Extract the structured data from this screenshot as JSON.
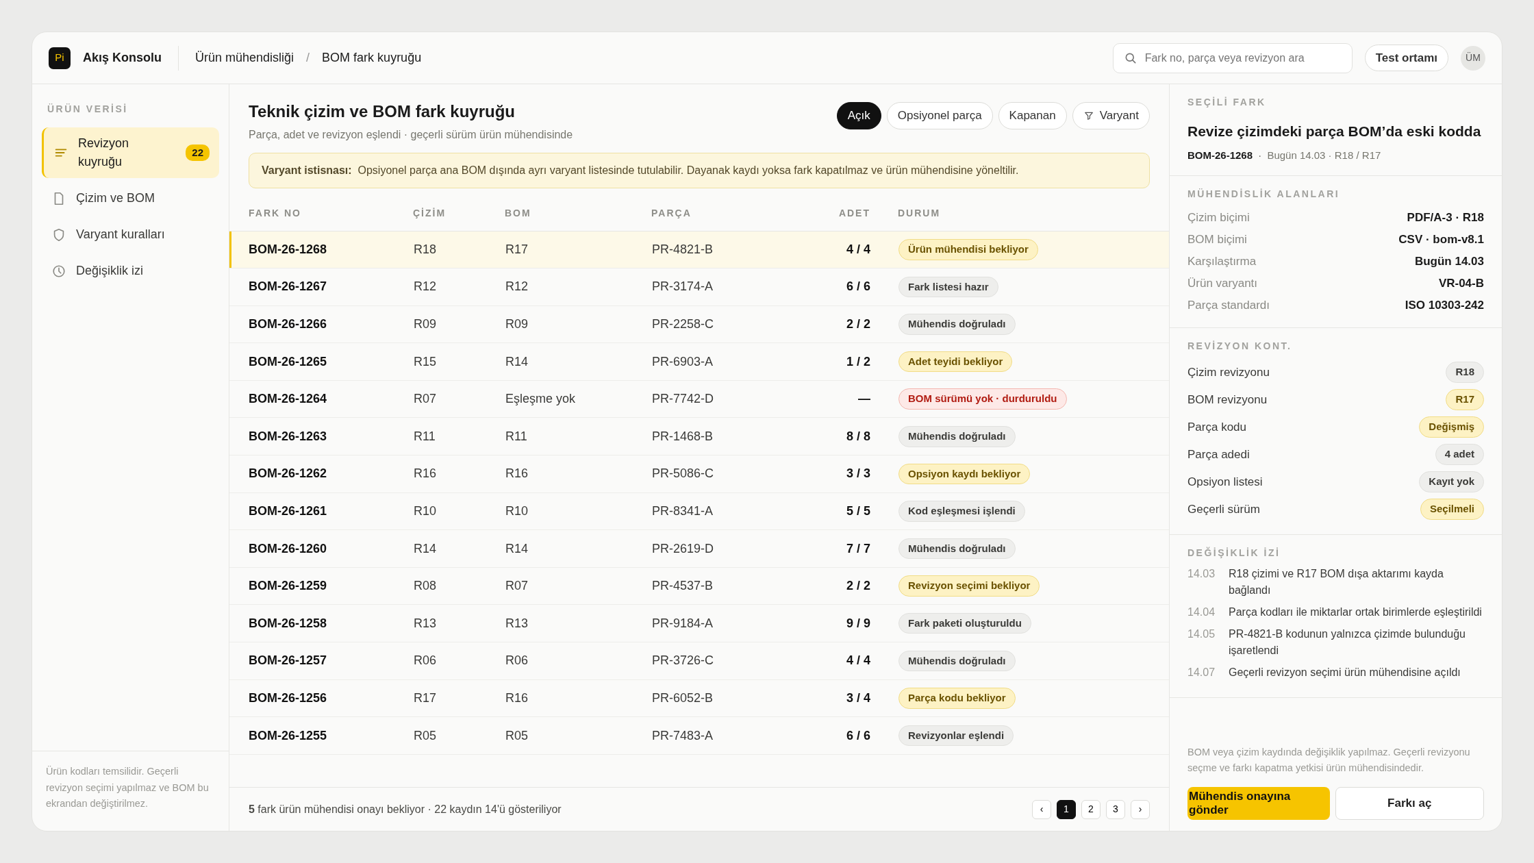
{
  "app": {
    "logo": "Pi",
    "name": "Akış Konsolu"
  },
  "breadcrumb": [
    "Ürün mühendisliği",
    "BOM fark kuyruğu"
  ],
  "breadcrumb_separator": "/",
  "search": {
    "placeholder": "Fark no, parça veya revizyon ara"
  },
  "environment": "Test ortamı",
  "avatar": "ÜM",
  "sidebar": {
    "heading": "ÜRÜN VERİSİ",
    "items": [
      {
        "label": "Revizyon kuyruğu",
        "badge": "22",
        "selected": true
      },
      {
        "label": "Çizim ve BOM",
        "selected": false
      },
      {
        "label": "Varyant kuralları",
        "selected": false
      },
      {
        "label": "Değişiklik izi",
        "selected": false
      }
    ],
    "note": "Ürün kodları temsilidir. Geçerli revizyon seçimi yapılmaz ve BOM bu ekrandan değiştirilmez."
  },
  "main": {
    "title": "Teknik çizim ve BOM fark kuyruğu",
    "subtitle": "Parça, adet ve revizyon eşlendi · geçerli sürüm ürün mühendisinde",
    "filters": [
      {
        "label": "Açık",
        "selected": true
      },
      {
        "label": "Opsiyonel parça",
        "selected": false
      },
      {
        "label": "Kapanan",
        "selected": false
      },
      {
        "label": "Varyant",
        "selected": false,
        "kind": "filter"
      }
    ],
    "alert": {
      "label": "Varyant istisnası:",
      "text": "Opsiyonel parça ana BOM dışında ayrı varyant listesinde tutulabilir. Dayanak kaydı yoksa fark kapatılmaz ve ürün mühendisine yöneltilir."
    }
  },
  "table": {
    "columns": [
      "FARK NO",
      "ÇİZİM",
      "BOM",
      "PARÇA",
      "ADET",
      "DURUM"
    ],
    "rows": [
      {
        "id": "BOM-26-1268",
        "drawing": "R18",
        "bom": "R17",
        "part": "PR-4821-B",
        "qty": "4 / 4",
        "status": "Ürün mühendisi bekliyor",
        "kind": "warning",
        "selected": true
      },
      {
        "id": "BOM-26-1267",
        "drawing": "R12",
        "bom": "R12",
        "part": "PR-3174-A",
        "qty": "6 / 6",
        "status": "Fark listesi hazır",
        "kind": "neutral",
        "selected": false
      },
      {
        "id": "BOM-26-1266",
        "drawing": "R09",
        "bom": "R09",
        "part": "PR-2258-C",
        "qty": "2 / 2",
        "status": "Mühendis doğruladı",
        "kind": "neutral",
        "selected": false
      },
      {
        "id": "BOM-26-1265",
        "drawing": "R15",
        "bom": "R14",
        "part": "PR-6903-A",
        "qty": "1 / 2",
        "status": "Adet teyidi bekliyor",
        "kind": "warning",
        "selected": false
      },
      {
        "id": "BOM-26-1264",
        "drawing": "R07",
        "bom": "Eşleşme yok",
        "part": "PR-7742-D",
        "qty": "—",
        "status": "BOM sürümü yok · durduruldu",
        "kind": "danger",
        "selected": false
      },
      {
        "id": "BOM-26-1263",
        "drawing": "R11",
        "bom": "R11",
        "part": "PR-1468-B",
        "qty": "8 / 8",
        "status": "Mühendis doğruladı",
        "kind": "neutral",
        "selected": false
      },
      {
        "id": "BOM-26-1262",
        "drawing": "R16",
        "bom": "R16",
        "part": "PR-5086-C",
        "qty": "3 / 3",
        "status": "Opsiyon kaydı bekliyor",
        "kind": "warning",
        "selected": false
      },
      {
        "id": "BOM-26-1261",
        "drawing": "R10",
        "bom": "R10",
        "part": "PR-8341-A",
        "qty": "5 / 5",
        "status": "Kod eşleşmesi işlendi",
        "kind": "neutral",
        "selected": false
      },
      {
        "id": "BOM-26-1260",
        "drawing": "R14",
        "bom": "R14",
        "part": "PR-2619-D",
        "qty": "7 / 7",
        "status": "Mühendis doğruladı",
        "kind": "neutral",
        "selected": false
      },
      {
        "id": "BOM-26-1259",
        "drawing": "R08",
        "bom": "R07",
        "part": "PR-4537-B",
        "qty": "2 / 2",
        "status": "Revizyon seçimi bekliyor",
        "kind": "warning",
        "selected": false
      },
      {
        "id": "BOM-26-1258",
        "drawing": "R13",
        "bom": "R13",
        "part": "PR-9184-A",
        "qty": "9 / 9",
        "status": "Fark paketi oluşturuldu",
        "kind": "neutral",
        "selected": false
      },
      {
        "id": "BOM-26-1257",
        "drawing": "R06",
        "bom": "R06",
        "part": "PR-3726-C",
        "qty": "4 / 4",
        "status": "Mühendis doğruladı",
        "kind": "neutral",
        "selected": false
      },
      {
        "id": "BOM-26-1256",
        "drawing": "R17",
        "bom": "R16",
        "part": "PR-6052-B",
        "qty": "3 / 4",
        "status": "Parça kodu bekliyor",
        "kind": "warning",
        "selected": false
      },
      {
        "id": "BOM-26-1255",
        "drawing": "R05",
        "bom": "R05",
        "part": "PR-7483-A",
        "qty": "6 / 6",
        "status": "Revizyonlar eşlendi",
        "kind": "neutral",
        "selected": false
      }
    ]
  },
  "status_bar": {
    "text": "**5** fark ürün mühendisi onayı bekliyor · 22 kaydın 14'ü gösteriliyor",
    "pages": [
      {
        "label": "‹",
        "selected": false
      },
      {
        "label": "1",
        "selected": true
      },
      {
        "label": "2",
        "selected": false
      },
      {
        "label": "3",
        "selected": false
      },
      {
        "label": "›",
        "selected": false
      }
    ]
  },
  "detail": {
    "heading": "SEÇİLİ FARK",
    "title": "Revize çizimdeki parça BOM’da eski kodda",
    "id": "BOM-26-1268",
    "meta_separator": "·",
    "meta": "Bugün 14.03 · R18 / R17",
    "fields_heading": "MÜHENDİSLİK ALANLARI",
    "fields": [
      {
        "label": "Çizim biçimi",
        "value": "PDF/A-3 · R18"
      },
      {
        "label": "BOM biçimi",
        "value": "CSV · bom-v8.1"
      },
      {
        "label": "Karşılaştırma",
        "value": "Bugün 14.03"
      },
      {
        "label": "Ürün varyantı",
        "value": "VR-04-B"
      },
      {
        "label": "Parça standardı",
        "value": "ISO 10303-242"
      }
    ],
    "checks_heading": "REVİZYON KONT.",
    "checks": [
      {
        "label": "Çizim revizyonu",
        "value": "R18",
        "kind": "neutral"
      },
      {
        "label": "BOM revizyonu",
        "value": "R17",
        "kind": "warning"
      },
      {
        "label": "Parça kodu",
        "value": "Değişmiş",
        "kind": "warning"
      },
      {
        "label": "Parça adedi",
        "value": "4 adet",
        "kind": "neutral"
      },
      {
        "label": "Opsiyon listesi",
        "value": "Kayıt yok",
        "kind": "neutral"
      },
      {
        "label": "Geçerli sürüm",
        "value": "Seçilmeli",
        "kind": "warning"
      }
    ],
    "log_heading": "DEĞİŞİKLİK İZİ",
    "log": [
      {
        "time": "14.03",
        "text": "R18 çizimi ve R17 BOM dışa aktarımı kayda bağlandı"
      },
      {
        "time": "14.04",
        "text": "Parça kodları ile miktarlar ortak birimlerde eşleştirildi"
      },
      {
        "time": "14.05",
        "text": "PR-4821-B kodunun yalnızca çizimde bulunduğu işaretlendi"
      },
      {
        "time": "14.07",
        "text": "Geçerli revizyon seçimi ürün mühendisine açıldı"
      }
    ],
    "note": "BOM veya çizim kaydında değişiklik yapılmaz. Geçerli revizyonu seçme ve farkı kapatma yetkisi ürün mühendisindedir.",
    "actions": [
      {
        "label": "Mühendis onayına gönder",
        "kind": "primary"
      },
      {
        "label": "Farkı aç",
        "kind": "secondary"
      }
    ]
  }
}
